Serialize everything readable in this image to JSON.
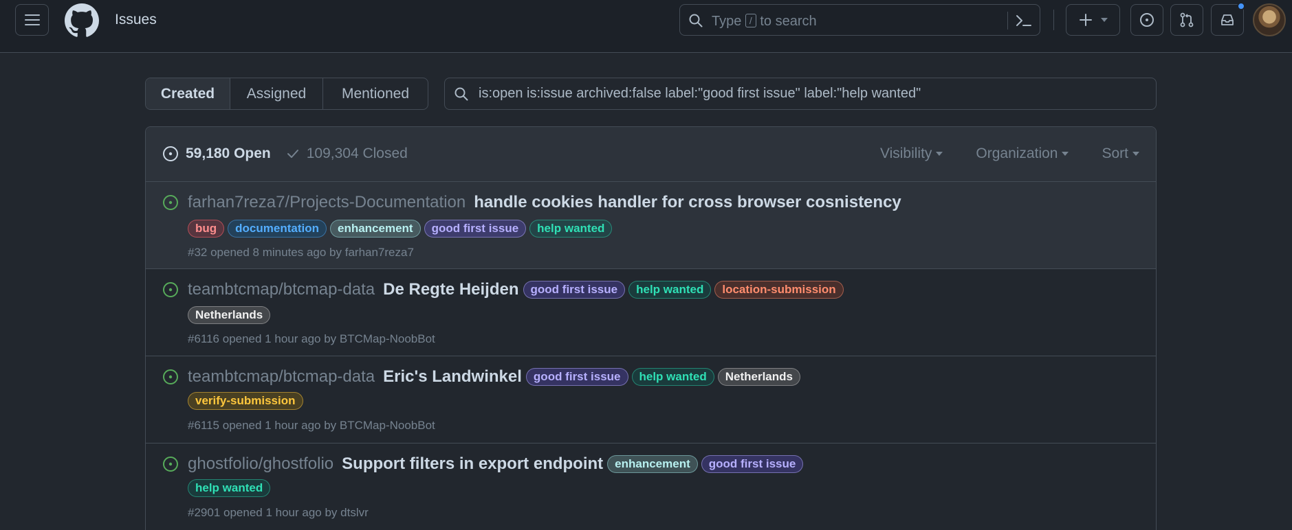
{
  "header": {
    "title": "Issues",
    "search_placeholder_pre": "Type",
    "search_placeholder_key": "/",
    "search_placeholder_post": "to search",
    "has_notification": true
  },
  "filter": {
    "tabs": [
      {
        "label": "Created",
        "active": true
      },
      {
        "label": "Assigned",
        "active": false
      },
      {
        "label": "Mentioned",
        "active": false
      }
    ],
    "query": "is:open is:issue archived:false label:\"good first issue\" label:\"help wanted\""
  },
  "list_header": {
    "open_label": "59,180 Open",
    "closed_label": "109,304 Closed",
    "dropdowns": [
      "Visibility",
      "Organization",
      "Sort"
    ]
  },
  "issues": [
    {
      "repo": "farhan7reza7/Projects-Documentation",
      "title": "handle cookies handler for cross browser cosnistency",
      "labels": [
        {
          "text": "bug",
          "kind": "bug"
        },
        {
          "text": "documentation",
          "kind": "doc"
        },
        {
          "text": "enhancement",
          "kind": "enh"
        },
        {
          "text": "good first issue",
          "kind": "gfi"
        },
        {
          "text": "help wanted",
          "kind": "hw"
        }
      ],
      "meta": "#32 opened 8 minutes ago by farhan7reza7"
    },
    {
      "repo": "teambtcmap/btcmap-data",
      "title": "De Regte Heijden",
      "labels": [
        {
          "text": "good first issue",
          "kind": "gfi"
        },
        {
          "text": "help wanted",
          "kind": "hw"
        },
        {
          "text": "location-submission",
          "kind": "loc"
        },
        {
          "text": "Netherlands",
          "kind": "nl"
        }
      ],
      "meta": "#6116 opened 1 hour ago by BTCMap-NoobBot"
    },
    {
      "repo": "teambtcmap/btcmap-data",
      "title": "Eric's Landwinkel",
      "labels": [
        {
          "text": "good first issue",
          "kind": "gfi"
        },
        {
          "text": "help wanted",
          "kind": "hw"
        },
        {
          "text": "Netherlands",
          "kind": "nl"
        },
        {
          "text": "verify-submission",
          "kind": "ver"
        }
      ],
      "meta": "#6115 opened 1 hour ago by BTCMap-NoobBot"
    },
    {
      "repo": "ghostfolio/ghostfolio",
      "title": "Support filters in export endpoint",
      "labels": [
        {
          "text": "enhancement",
          "kind": "enh"
        },
        {
          "text": "good first issue",
          "kind": "gfi"
        },
        {
          "text": "help wanted",
          "kind": "hw"
        }
      ],
      "meta": "#2901 opened 1 hour ago by dtslvr"
    }
  ]
}
